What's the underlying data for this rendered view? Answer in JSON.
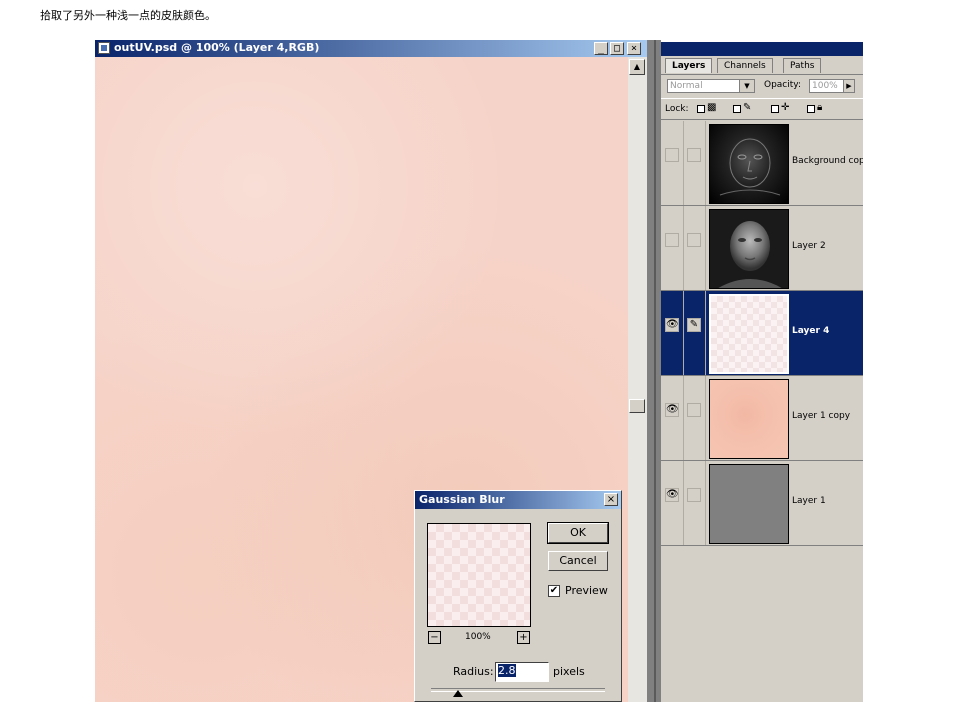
{
  "caption": "拾取了另外一种浅一点的皮肤颜色。",
  "document": {
    "title": "outUV.psd @ 100% (Layer 4,RGB)",
    "btn_min": "_",
    "btn_max": "□",
    "btn_close": "×"
  },
  "layers_panel": {
    "tabs": [
      "Layers",
      "Channels",
      "Paths"
    ],
    "blend_mode": "Normal",
    "opacity_label": "Opacity:",
    "opacity_value": "100%",
    "lock_label": "Lock:",
    "layers": [
      {
        "name": "Background copy",
        "visible": false,
        "selected": false
      },
      {
        "name": "Layer 2",
        "visible": false,
        "selected": false
      },
      {
        "name": "Layer 4",
        "visible": true,
        "selected": true
      },
      {
        "name": "Layer 1 copy",
        "visible": true,
        "selected": false
      },
      {
        "name": "Layer 1",
        "visible": true,
        "selected": false
      }
    ]
  },
  "gaussian_blur": {
    "title": "Gaussian Blur",
    "ok_label": "OK",
    "cancel_label": "Cancel",
    "preview_label": "Preview",
    "preview_checked": true,
    "zoom": "100%",
    "radius_label": "Radius:",
    "radius_value": "2.8",
    "unit": "pixels"
  }
}
